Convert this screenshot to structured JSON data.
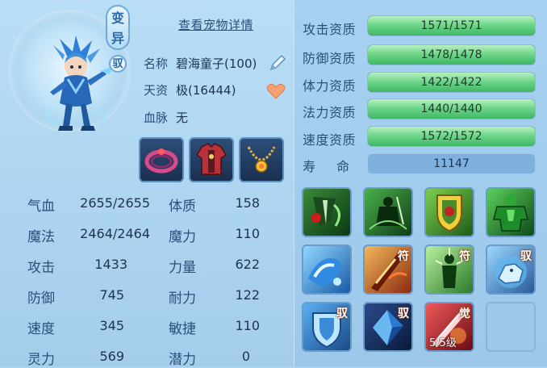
{
  "pet": {
    "mutation_badge": "变异",
    "bound_badge": "驭",
    "view_details_link": "查看宠物详情",
    "name_label": "名称",
    "name_value": "碧海童子(100)",
    "talent_label": "天资",
    "talent_value": "极(16444)",
    "bloodline_label": "血脉",
    "bloodline_value": "无"
  },
  "equipment": [
    {
      "icon": "ring-equipment-icon"
    },
    {
      "icon": "armor-equipment-icon"
    },
    {
      "icon": "necklace-equipment-icon"
    }
  ],
  "stats": [
    {
      "label": "气血",
      "value": "2655/2655",
      "attr_label": "体质",
      "attr_value": "158"
    },
    {
      "label": "魔法",
      "value": "2464/2464",
      "attr_label": "魔力",
      "attr_value": "110"
    },
    {
      "label": "攻击",
      "value": "1433",
      "attr_label": "力量",
      "attr_value": "622"
    },
    {
      "label": "防御",
      "value": "745",
      "attr_label": "耐力",
      "attr_value": "122"
    },
    {
      "label": "速度",
      "value": "345",
      "attr_label": "敏捷",
      "attr_value": "110"
    },
    {
      "label": "灵力",
      "value": "569",
      "attr_label": "潜力",
      "attr_value": "0"
    }
  ],
  "aptitudes": [
    {
      "label": "攻击资质",
      "value": "1571/1571",
      "fill": 1.0
    },
    {
      "label": "防御资质",
      "value": "1478/1478",
      "fill": 1.0
    },
    {
      "label": "体力资质",
      "value": "1422/1422",
      "fill": 1.0
    },
    {
      "label": "法力资质",
      "value": "1440/1440",
      "fill": 1.0
    },
    {
      "label": "速度资质",
      "value": "1572/1572",
      "fill": 1.0
    }
  ],
  "lifespan": {
    "label": "寿 命",
    "value": "11147"
  },
  "skills": [
    {
      "icon": "blood-sword-skill-icon",
      "tag": ""
    },
    {
      "icon": "shadow-warrior-skill-icon",
      "tag": ""
    },
    {
      "icon": "shield-emblem-skill-icon",
      "tag": ""
    },
    {
      "icon": "green-giant-skill-icon",
      "tag": ""
    },
    {
      "icon": "water-wave-skill-icon",
      "tag": ""
    },
    {
      "icon": "fire-slash-skill-icon",
      "tag": "符"
    },
    {
      "icon": "light-figure-skill-icon",
      "tag": "符"
    },
    {
      "icon": "ice-beast-skill-icon",
      "tag": "驭"
    },
    {
      "icon": "shield-skill-icon",
      "tag": "驭"
    },
    {
      "icon": "crystal-skill-icon",
      "tag": "驭"
    },
    {
      "icon": "awaken-skill-icon",
      "tag": "觉",
      "level": "5/5级"
    },
    {
      "icon": "empty-slot",
      "tag": ""
    }
  ],
  "colors": {
    "accent_green": "#3eb864",
    "label_blue": "#2a4f79"
  }
}
